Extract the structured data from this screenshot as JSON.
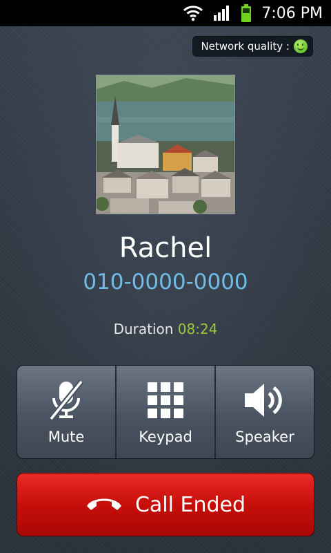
{
  "status_bar": {
    "time": "7:06 PM",
    "icons": [
      "wifi-icon",
      "signal-icon",
      "battery-icon"
    ]
  },
  "network_quality": {
    "label": "Network quality :",
    "indicator_icon": "smiley-icon"
  },
  "contact": {
    "name": "Rachel",
    "number": "010-0000-0000",
    "photo_icon": "landscape-photo"
  },
  "call": {
    "duration_label": "Duration",
    "duration_value": "08:24"
  },
  "actions": {
    "mute_label": "Mute",
    "keypad_label": "Keypad",
    "speaker_label": "Speaker"
  },
  "end_call": {
    "label": "Call Ended",
    "icon": "hang-up-icon"
  },
  "colors": {
    "number": "#6fbde6",
    "duration_value": "#9bc83a",
    "end_call": "#d3140f"
  }
}
